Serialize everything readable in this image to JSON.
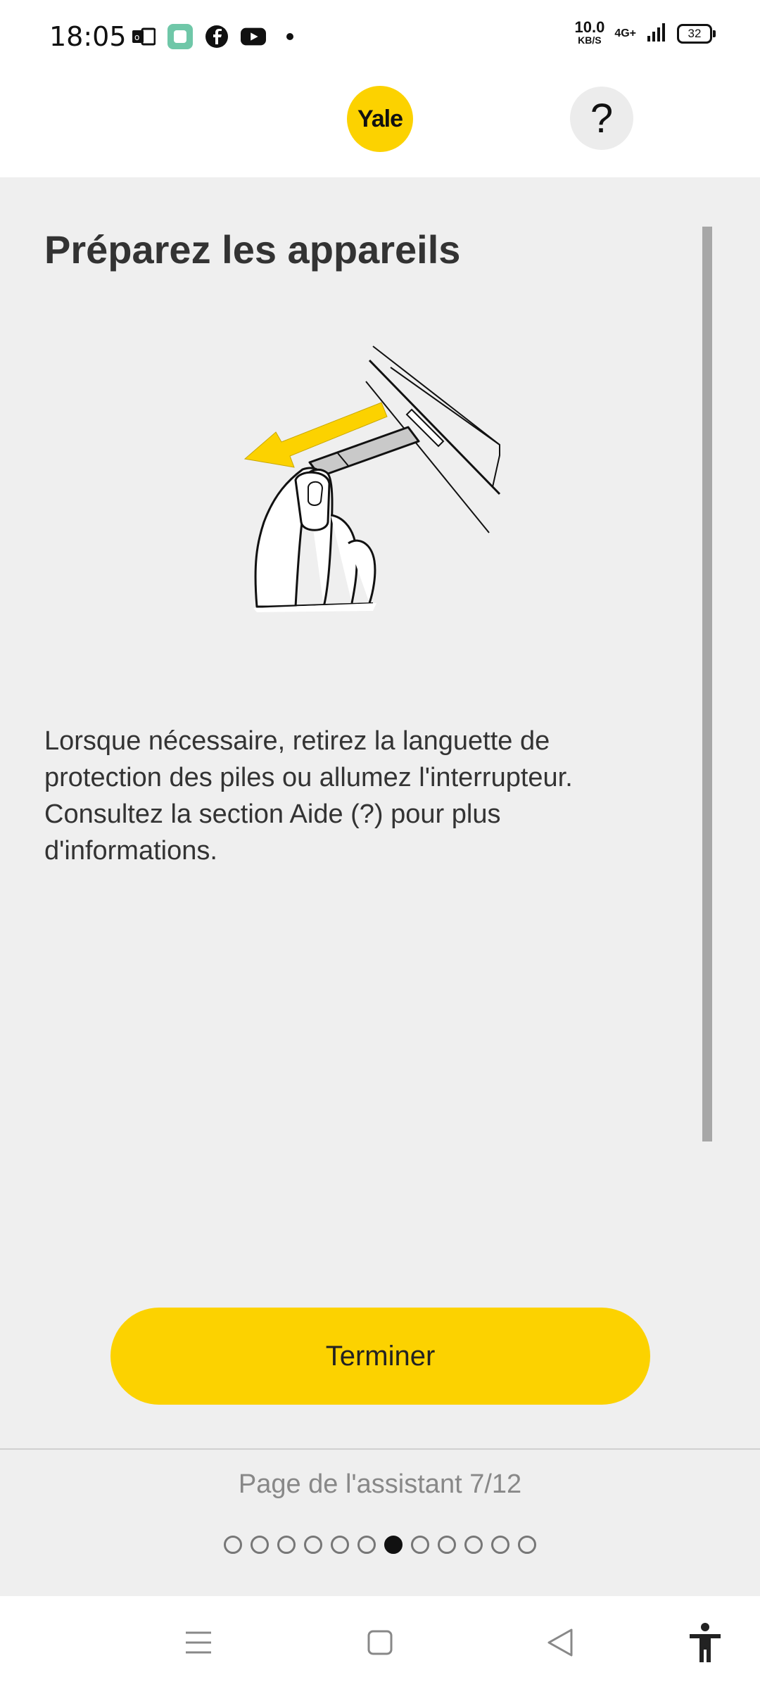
{
  "status_bar": {
    "time": "18:05",
    "speed_value": "10.0",
    "speed_unit": "KB/S",
    "network": "4G+",
    "battery": "32",
    "icons": [
      "notification-app-icon",
      "gallery-app-icon",
      "facebook-icon",
      "youtube-icon",
      "more-dot-icon",
      "signal-icon"
    ]
  },
  "header": {
    "logo_text": "Yale",
    "help_label": "?"
  },
  "main": {
    "title": "Préparez les appareils",
    "body": "Lorsque nécessaire, retirez la languette de protection des piles ou allumez l'interrupteur. Consultez la section Aide (?) pour plus d'informations.",
    "finish_button": "Terminer",
    "illustration_icon": "battery-tab-removal-illustration"
  },
  "footer": {
    "page_label": "Page de l'assistant 7/12",
    "total_pages": 12,
    "current_page": 7
  },
  "nav_bar": {
    "icons": [
      "menu-icon",
      "home-icon",
      "back-icon",
      "accessibility-icon"
    ]
  },
  "colors": {
    "accent": "#fcd200",
    "background": "#efefef"
  }
}
